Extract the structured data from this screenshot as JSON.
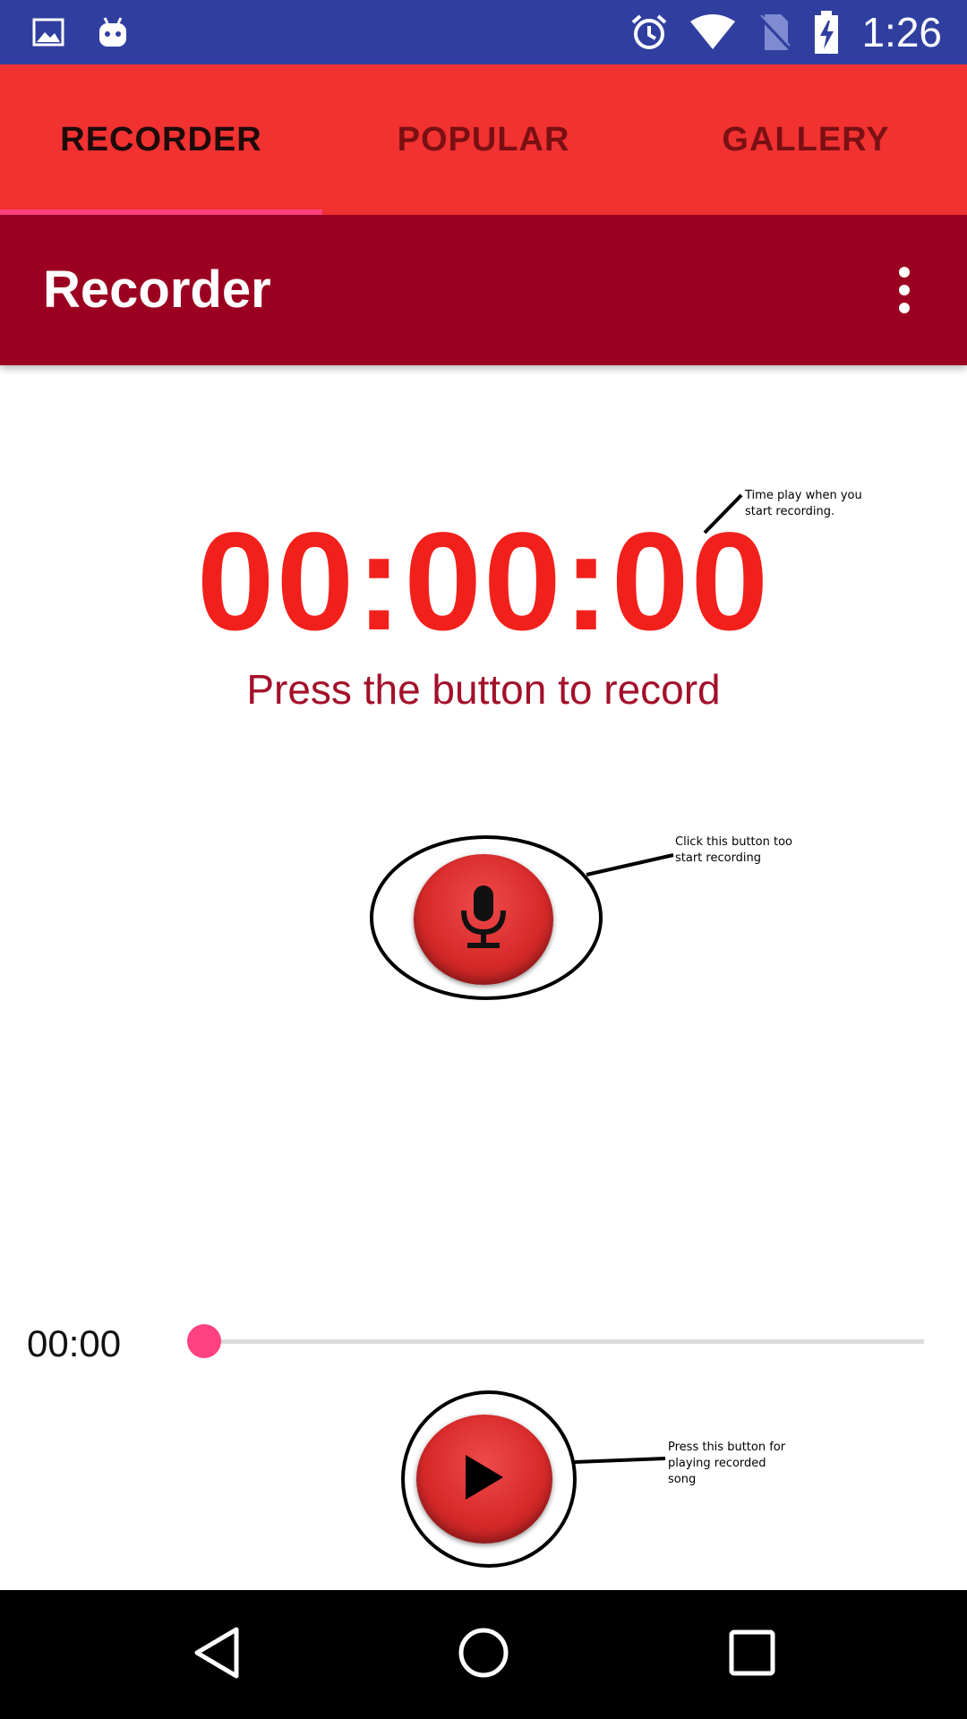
{
  "status_bar": {
    "time": "1:26",
    "icons": [
      "image-icon",
      "android-icon",
      "alarm-icon",
      "wifi-icon",
      "no-sim-icon",
      "battery-charging-icon"
    ]
  },
  "tabs": [
    {
      "label": "RECORDER",
      "active": true
    },
    {
      "label": "POPULAR",
      "active": false
    },
    {
      "label": "GALLERY",
      "active": false
    }
  ],
  "toolbar": {
    "title": "Recorder",
    "menu_icon": "more-vert-icon"
  },
  "recorder": {
    "timer": "00:00:00",
    "hint": "Press the button to record",
    "record_icon": "microphone-icon"
  },
  "player": {
    "elapsed": "00:00",
    "progress": 0,
    "play_icon": "play-icon"
  },
  "annotations": {
    "timer_note_line1": "Time play when you",
    "timer_note_line2": "start recording.",
    "record_note_line1": "Click this button too",
    "record_note_line2": "start recording",
    "play_note_line1": "Press this button for",
    "play_note_line2": "playing recorded",
    "play_note_line3": "song"
  },
  "colors": {
    "status_bar": "#303f9f",
    "tab_bar": "#f23131",
    "toolbar": "#9b0020",
    "accent": "#ff4081",
    "timer": "#f2201b"
  },
  "nav_bar": {
    "icons": [
      "back-icon",
      "home-icon",
      "recents-icon"
    ]
  }
}
